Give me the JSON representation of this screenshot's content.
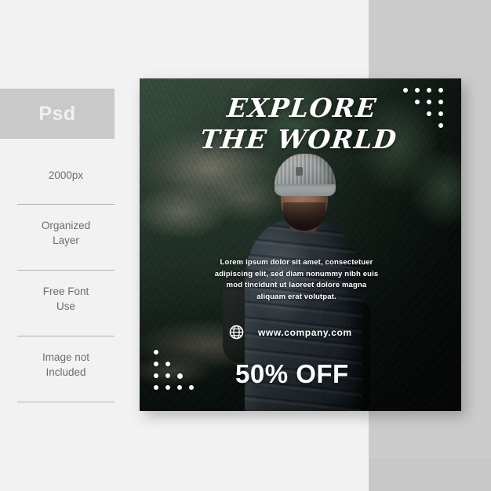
{
  "page": {
    "background_color": "#f2f2f2",
    "panel_color": "#cccccc"
  },
  "sidebar": {
    "badge": {
      "label": "Psd",
      "background_color": "#c9c9c9",
      "text_color": "#f0f0f0"
    },
    "features": [
      {
        "label": "2000px"
      },
      {
        "label": "Organized\nLayer",
        "line1": "Organized",
        "line2": "Layer"
      },
      {
        "label": "Free Font\nUse",
        "line1": "Free Font",
        "line2": "Use"
      },
      {
        "label": "Image not\nIncluded",
        "line1": "Image not",
        "line2": "Included"
      }
    ],
    "divider_color": "#b4b4b4",
    "text_color": "#6d6d6d"
  },
  "poster": {
    "headline": {
      "line1": "EXPLORE",
      "line2": "THE WORLD"
    },
    "body_copy": "Lorem ipsum dolor sit amet, consectetuer adipiscing elit, sed diam nonummy nibh euis mod tincidunt ut laoreet dolore magna aliquam erat volutpat.",
    "website": {
      "icon": "globe-icon",
      "url": "www.company.com"
    },
    "offer": "50% OFF",
    "text_color": "#ffffff",
    "decoration": {
      "top_right_dots": "inverted-triangle-4-3-2-1",
      "bottom_left_dots": "triangle-1-2-3-4",
      "dot_color": "#ffffff"
    },
    "photo": {
      "subject": "hiker in gray beanie and dark puffer jacket with backpack",
      "scene": "dark green forest with rocky outcrops"
    }
  }
}
